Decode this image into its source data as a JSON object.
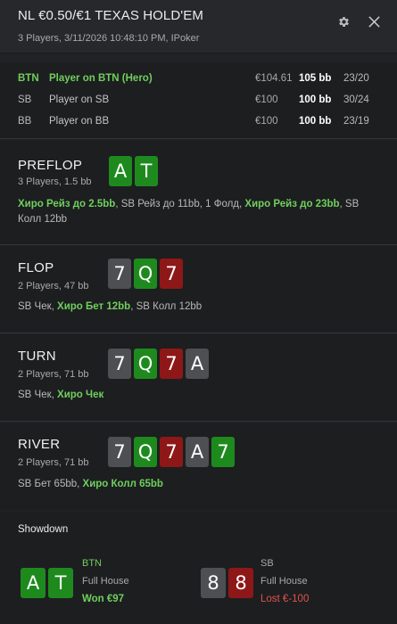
{
  "header": {
    "title": "NL €0.50/€1 TEXAS HOLD'EM",
    "subtitle": "3 Players, 3/11/2026 10:48:10 PM, IPoker",
    "settings_icon": "gear-icon",
    "close_icon": "close-icon"
  },
  "players": [
    {
      "position": "BTN",
      "name": "Player on BTN (Hero)",
      "stack": "€104.61",
      "bb": "105 bb",
      "cards": "23/20",
      "hero": true
    },
    {
      "position": "SB",
      "name": "Player on SB",
      "stack": "€100",
      "bb": "100 bb",
      "cards": "30/24",
      "hero": false
    },
    {
      "position": "BB",
      "name": "Player on BB",
      "stack": "€100",
      "bb": "100 bb",
      "cards": "23/19",
      "hero": false
    }
  ],
  "streets": [
    {
      "name": "PREFLOP",
      "info": "3 Players, 1.5 bb",
      "cards": [
        {
          "rank": "A",
          "color": "green"
        },
        {
          "rank": "T",
          "color": "green"
        }
      ],
      "actions": [
        {
          "text": "Хиро Рейз до 2.5bb",
          "hero": true
        },
        {
          "text": ", SB Рейз до 11bb, 1 Фолд, ",
          "hero": false
        },
        {
          "text": "Хиро Рейз до 23bb",
          "hero": true
        },
        {
          "text": ", SB Колл 12bb",
          "hero": false
        }
      ]
    },
    {
      "name": "FLOP",
      "info": "2 Players, 47 bb",
      "cards": [
        {
          "rank": "7",
          "color": "gray"
        },
        {
          "rank": "Q",
          "color": "green"
        },
        {
          "rank": "7",
          "color": "red"
        }
      ],
      "actions": [
        {
          "text": "SB Чек, ",
          "hero": false
        },
        {
          "text": "Хиро Бет 12bb",
          "hero": true
        },
        {
          "text": ", SB Колл 12bb",
          "hero": false
        }
      ]
    },
    {
      "name": "TURN",
      "info": "2 Players, 71 bb",
      "cards": [
        {
          "rank": "7",
          "color": "gray"
        },
        {
          "rank": "Q",
          "color": "green"
        },
        {
          "rank": "7",
          "color": "red"
        },
        {
          "rank": "A",
          "color": "gray"
        }
      ],
      "actions": [
        {
          "text": "SB Чек, ",
          "hero": false
        },
        {
          "text": "Хиро Чек",
          "hero": true
        }
      ]
    },
    {
      "name": "RIVER",
      "info": "2 Players, 71 bb",
      "cards": [
        {
          "rank": "7",
          "color": "gray"
        },
        {
          "rank": "Q",
          "color": "green"
        },
        {
          "rank": "7",
          "color": "red"
        },
        {
          "rank": "A",
          "color": "gray"
        },
        {
          "rank": "7",
          "color": "green"
        }
      ],
      "actions": [
        {
          "text": "SB Бет 65bb, ",
          "hero": false
        },
        {
          "text": "Хиро Колл 65bb",
          "hero": true
        }
      ]
    }
  ],
  "showdown": {
    "title": "Showdown",
    "hands": [
      {
        "position": "BTN",
        "hand": "Full House",
        "result": "Won €97",
        "won": true,
        "hero": true,
        "cards": [
          {
            "rank": "A",
            "color": "green"
          },
          {
            "rank": "T",
            "color": "green"
          }
        ]
      },
      {
        "position": "SB",
        "hand": "Full House",
        "result": "Lost €-100",
        "won": false,
        "hero": false,
        "cards": [
          {
            "rank": "8",
            "color": "gray"
          },
          {
            "rank": "8",
            "color": "red"
          }
        ]
      }
    ]
  },
  "colors": {
    "hero_green": "#6fcf5c",
    "card_green": "#1e8a1e",
    "card_gray": "#4e4f52",
    "card_red": "#8e1717",
    "loss_red": "#e0524e"
  }
}
